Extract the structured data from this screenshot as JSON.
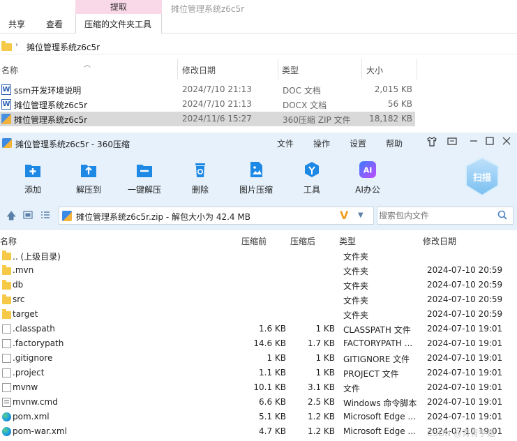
{
  "explorer": {
    "ribbon": {
      "context_tab_header": "提取",
      "ghost_title": "摊位管理系统z6c5r",
      "tabs": [
        "共享",
        "查看",
        "压缩的文件夹工具"
      ]
    },
    "address": "摊位管理系统z6c5r",
    "columns": {
      "name": "名称",
      "modified": "修改日期",
      "type": "类型",
      "size": "大小"
    },
    "files": [
      {
        "name": "ssm开发环境说明",
        "modified": "2024/7/10 21:13",
        "type": "DOC 文档",
        "size": "2,015 KB",
        "icon": "word-icon"
      },
      {
        "name": "摊位管理系统z6c5r",
        "modified": "2024/7/10 21:13",
        "type": "DOCX 文档",
        "size": "56 KB",
        "icon": "word-icon"
      },
      {
        "name": "摊位管理系统z6c5r",
        "modified": "2024/11/6 15:27",
        "type": "360压缩 ZIP 文件",
        "size": "18,182 KB",
        "icon": "zip-icon"
      }
    ]
  },
  "archiver": {
    "title": "摊位管理系统z6c5r - 360压缩",
    "menu": [
      "文件",
      "操作",
      "设置",
      "帮助"
    ],
    "tools": [
      {
        "label": "添加",
        "icon": "add-icon"
      },
      {
        "label": "解压到",
        "icon": "extract-to-icon"
      },
      {
        "label": "一键解压",
        "icon": "one-click-extract-icon"
      },
      {
        "label": "删除",
        "icon": "delete-icon"
      },
      {
        "label": "图片压缩",
        "icon": "image-compress-icon"
      },
      {
        "label": "工具",
        "icon": "tools-icon"
      },
      {
        "label": "AI办公",
        "icon": "ai-office-icon"
      }
    ],
    "scan_label": "扫描",
    "ai_badge": "AI",
    "path_text": "摊位管理系统z6c5r.zip - 解包大小为 42.4 MB",
    "search_placeholder": "搜索包内文件",
    "columns": {
      "name": "名称",
      "before": "压缩前",
      "after": "压缩后",
      "type": "类型",
      "modified": "修改日期"
    },
    "rows": [
      {
        "name": ".. (上级目录)",
        "before": "",
        "after": "",
        "type": "文件夹",
        "modified": "",
        "icon": "folder"
      },
      {
        "name": ".mvn",
        "before": "",
        "after": "",
        "type": "文件夹",
        "modified": "2024-07-10 20:59",
        "icon": "folder"
      },
      {
        "name": "db",
        "before": "",
        "after": "",
        "type": "文件夹",
        "modified": "2024-07-10 20:59",
        "icon": "folder"
      },
      {
        "name": "src",
        "before": "",
        "after": "",
        "type": "文件夹",
        "modified": "2024-07-10 20:59",
        "icon": "folder"
      },
      {
        "name": "target",
        "before": "",
        "after": "",
        "type": "文件夹",
        "modified": "2024-07-10 20:59",
        "icon": "folder"
      },
      {
        "name": ".classpath",
        "before": "1.6 KB",
        "after": "1 KB",
        "type": "CLASSPATH 文件",
        "modified": "2024-07-10 19:01",
        "icon": "doc"
      },
      {
        "name": ".factorypath",
        "before": "14.6 KB",
        "after": "1.7 KB",
        "type": "FACTORYPATH ...",
        "modified": "2024-07-10 19:01",
        "icon": "doc"
      },
      {
        "name": ".gitignore",
        "before": "1 KB",
        "after": "1 KB",
        "type": "GITIGNORE 文件",
        "modified": "2024-07-10 19:01",
        "icon": "doc"
      },
      {
        "name": ".project",
        "before": "1.1 KB",
        "after": "1 KB",
        "type": "PROJECT 文件",
        "modified": "2024-07-10 19:01",
        "icon": "doc"
      },
      {
        "name": "mvnw",
        "before": "10.1 KB",
        "after": "3.1 KB",
        "type": "文件",
        "modified": "2024-07-10 19:01",
        "icon": "doc"
      },
      {
        "name": "mvnw.cmd",
        "before": "6.6 KB",
        "after": "2.5 KB",
        "type": "Windows 命令脚本",
        "modified": "2024-07-10 19:01",
        "icon": "cmd"
      },
      {
        "name": "pom.xml",
        "before": "5.1 KB",
        "after": "1.2 KB",
        "type": "Microsoft Edge ...",
        "modified": "2024-07-10 19:01",
        "icon": "edge"
      },
      {
        "name": "pom-war.xml",
        "before": "4.7 KB",
        "after": "1.2 KB",
        "type": "Microsoft Edge ...",
        "modified": "2024-07-10 19:01",
        "icon": "edge"
      }
    ]
  },
  "watermark": "CSDN @青青宇姐",
  "colors": {
    "accent": "#1e88e5",
    "toolbar_bg": "#e6f1fb",
    "selection": "#d9d9d9"
  }
}
